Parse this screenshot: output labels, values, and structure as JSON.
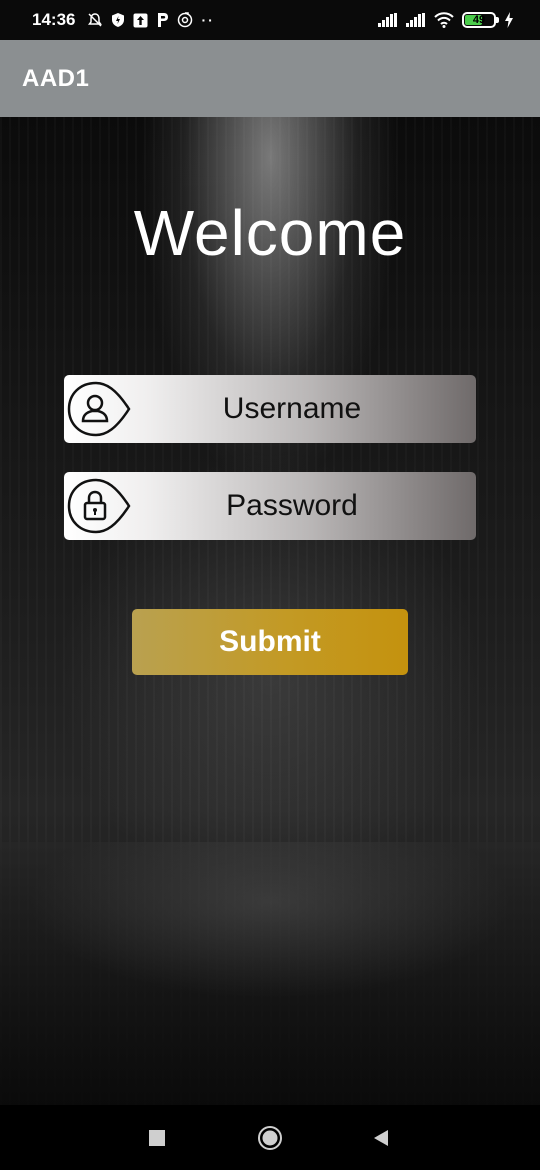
{
  "status_bar": {
    "time": "14:36",
    "battery_percent": "49",
    "left_icons": [
      "bell-off-icon",
      "shield-icon",
      "upload-icon",
      "p-icon",
      "music-icon",
      "more-dots-icon"
    ],
    "right_icons": [
      "signal-icon",
      "signal-icon",
      "wifi-icon",
      "battery-icon",
      "charging-icon"
    ]
  },
  "app_bar": {
    "title": "AAD1"
  },
  "login": {
    "heading": "Welcome",
    "username_placeholder": "Username",
    "password_placeholder": "Password",
    "submit_label": "Submit"
  },
  "nav_bar": {
    "buttons": [
      "recents-square-icon",
      "home-circle-icon",
      "back-triangle-icon"
    ]
  },
  "colors": {
    "app_bar": "#8b8f91",
    "submit_start": "#b9a150",
    "submit_end": "#c4920e"
  }
}
